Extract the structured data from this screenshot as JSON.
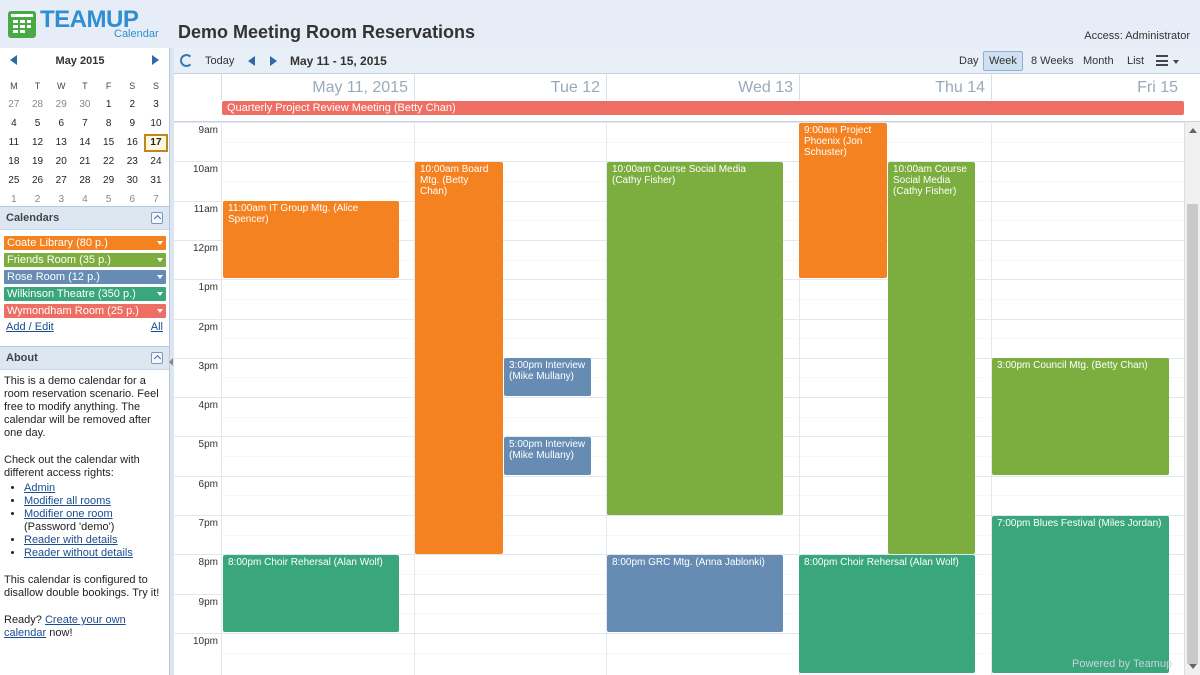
{
  "header": {
    "logo_name": "TEAMUP",
    "logo_sub": "Calendar",
    "title": "Demo Meeting Room Reservations",
    "access": "Access: Administrator"
  },
  "minical": {
    "month": "May 2015",
    "dow": [
      "M",
      "T",
      "W",
      "T",
      "F",
      "S",
      "S"
    ],
    "weeks": [
      [
        "27",
        "28",
        "29",
        "30",
        "1",
        "2",
        "3"
      ],
      [
        "4",
        "5",
        "6",
        "7",
        "8",
        "9",
        "10"
      ],
      [
        "11",
        "12",
        "13",
        "14",
        "15",
        "16",
        "17"
      ],
      [
        "18",
        "19",
        "20",
        "21",
        "22",
        "23",
        "24"
      ],
      [
        "25",
        "26",
        "27",
        "28",
        "29",
        "30",
        "31"
      ],
      [
        "1",
        "2",
        "3",
        "4",
        "5",
        "6",
        "7"
      ]
    ],
    "today": "17"
  },
  "calendars": {
    "title": "Calendars",
    "items": [
      {
        "label": "Coate Library (80 p.)",
        "color": "#f58220"
      },
      {
        "label": "Friends Room (35 p.)",
        "color": "#7cad3f"
      },
      {
        "label": "Rose Room (12 p.)",
        "color": "#668cb3"
      },
      {
        "label": "Wilkinson Theatre (350 p.)",
        "color": "#3aa67c"
      },
      {
        "label": "Wymondham Room (25 p.)",
        "color": "#ee6e64"
      }
    ],
    "add_edit": "Add / Edit",
    "all": "All"
  },
  "about": {
    "title": "About",
    "p1": "This is a demo calendar for a room reservation scenario. Feel free to modify anything. The calendar will be removed after one day.",
    "p2": "Check out the calendar with different access rights:",
    "links": [
      "Admin",
      "Modifier all rooms",
      "Modifier one room",
      "Reader with details",
      "Reader without details"
    ],
    "password_note": "(Password 'demo')",
    "p3": "This calendar is configured to disallow double bookings. Try it!",
    "p4_prefix": "Ready?",
    "p4_link": "Create your own calendar",
    "p4_suffix": "now!"
  },
  "toolbar": {
    "today": "Today",
    "range": "May 11 - 15, 2015",
    "views": [
      "Day",
      "Week",
      "8 Weeks",
      "Month",
      "List"
    ],
    "active_view": "Week"
  },
  "days": [
    "May 11, 2015",
    "Tue 12",
    "Wed 13",
    "Thu 14",
    "Fri 15"
  ],
  "allday_event": "Quarterly Project Review Meeting (Betty Chan)",
  "hours": [
    "9am",
    "10am",
    "11am",
    "12pm",
    "1pm",
    "2pm",
    "3pm",
    "4pm",
    "5pm",
    "6pm",
    "7pm",
    "8pm",
    "9pm",
    "10pm"
  ],
  "events": {
    "it_group": "11:00am IT Group Mtg. (Alice Spencer)",
    "choir_mon": "8:00pm Choir Rehersal (Alan Wolf)",
    "board": "10:00am Board Mtg. (Betty Chan)",
    "interview_3": "3:00pm Interview (Mike Mullany)",
    "interview_5": "5:00pm Interview (Mike Mullany)",
    "course_wed": "10:00am Course Social Media (Cathy Fisher)",
    "grc": "8:00pm GRC Mtg. (Anna Jablonki)",
    "phoenix": "9:00am Project Phoenix (Jon Schuster)",
    "course_thu": "10:00am Course Social Media (Cathy Fisher)",
    "choir_thu": "8:00pm Choir Rehersal (Alan Wolf)",
    "council": "3:00pm Council Mtg. (Betty Chan)",
    "blues": "7:00pm Blues Festival (Miles Jordan)"
  },
  "colors": {
    "orange": "#f58220",
    "green": "#7cad3f",
    "blue": "#668cb3",
    "teal": "#3aa67c",
    "red": "#ee6e64"
  },
  "powered": "Powered by Teamup"
}
